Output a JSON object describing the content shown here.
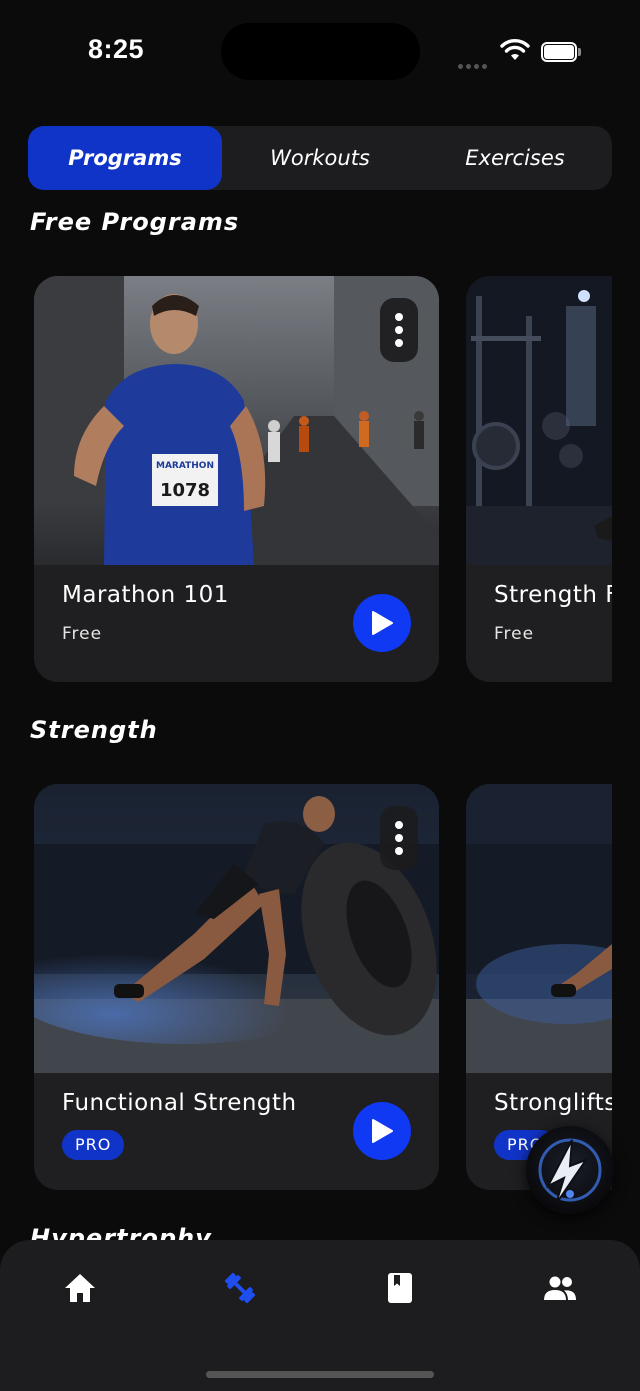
{
  "status_bar": {
    "time": "8:25"
  },
  "tabs": [
    {
      "label": "Programs",
      "active": true
    },
    {
      "label": "Workouts",
      "active": false
    },
    {
      "label": "Exercises",
      "active": false
    }
  ],
  "sections": [
    {
      "title": "Free Programs",
      "cards": [
        {
          "title": "Marathon 101",
          "subtitle": "Free"
        },
        {
          "title": "Strength F",
          "subtitle": "Free"
        }
      ]
    },
    {
      "title": "Strength",
      "cards": [
        {
          "title": "Functional Strength",
          "badge": "PRO"
        },
        {
          "title": "Stronglifts",
          "badge": "PRO"
        }
      ]
    },
    {
      "title": "Hypertrophy"
    }
  ],
  "bottom_nav": [
    {
      "icon": "home-icon",
      "active": false
    },
    {
      "icon": "dumbbell-icon",
      "active": true
    },
    {
      "icon": "book-icon",
      "active": false
    },
    {
      "icon": "people-icon",
      "active": false
    }
  ],
  "colors": {
    "accent": "#1034c7",
    "play": "#0f39f2",
    "background": "#0b0b0c",
    "card": "#1f1f21"
  }
}
